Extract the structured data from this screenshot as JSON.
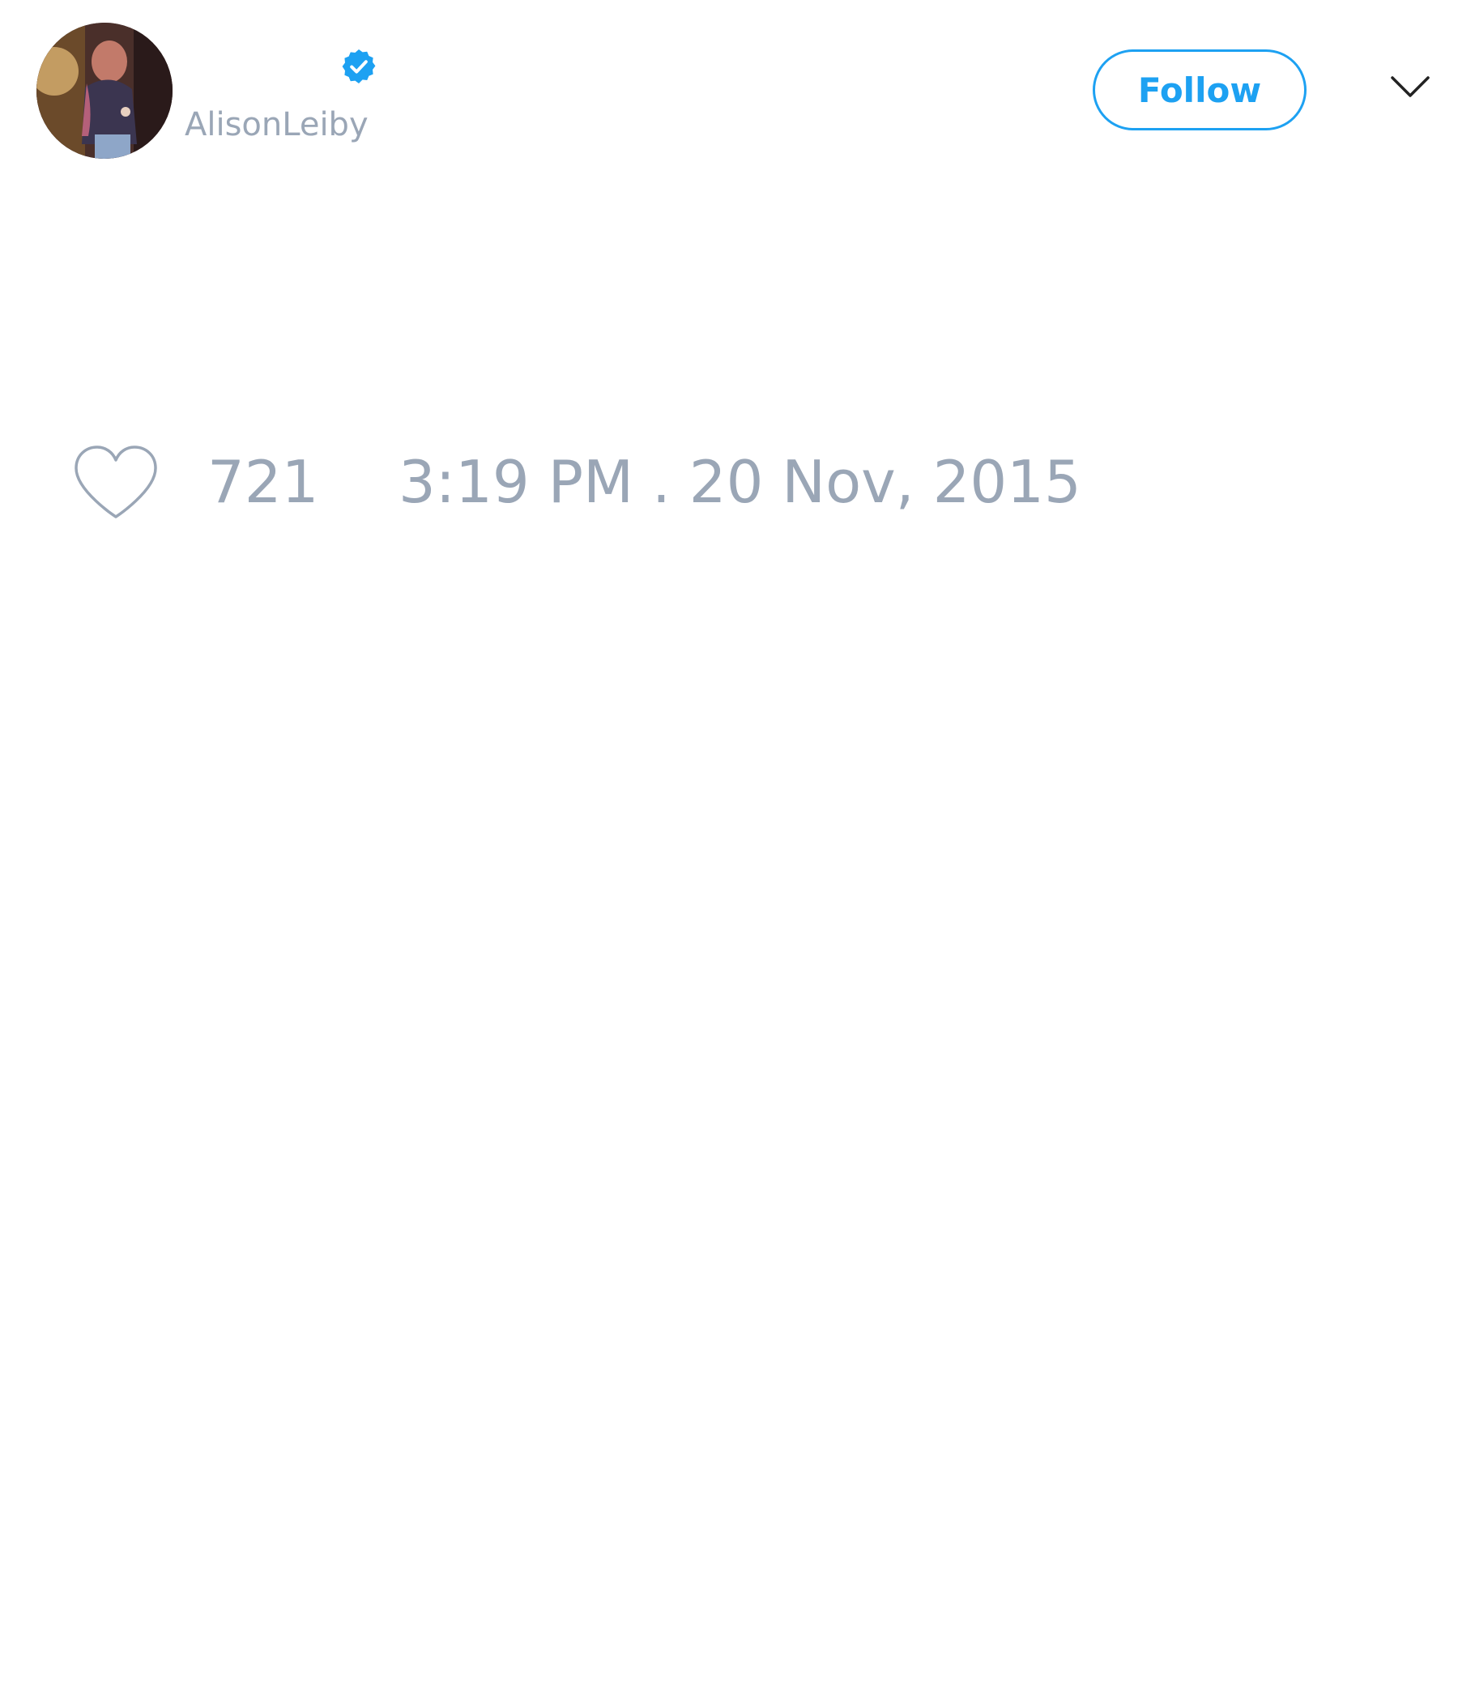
{
  "author": {
    "handle": "AlisonLeiby",
    "verified": true,
    "avatar_icon": "profile-photo"
  },
  "header": {
    "follow_label": "Follow",
    "menu_icon": "chevron-down-icon"
  },
  "tweet": {
    "likes": "721",
    "timestamp": "3:19 PM . 20 Nov, 2015",
    "like_icon": "heart-outline-icon"
  },
  "colors": {
    "accent": "#1da1f2",
    "muted_text": "#9aa6b6",
    "background": "#ffffff"
  }
}
